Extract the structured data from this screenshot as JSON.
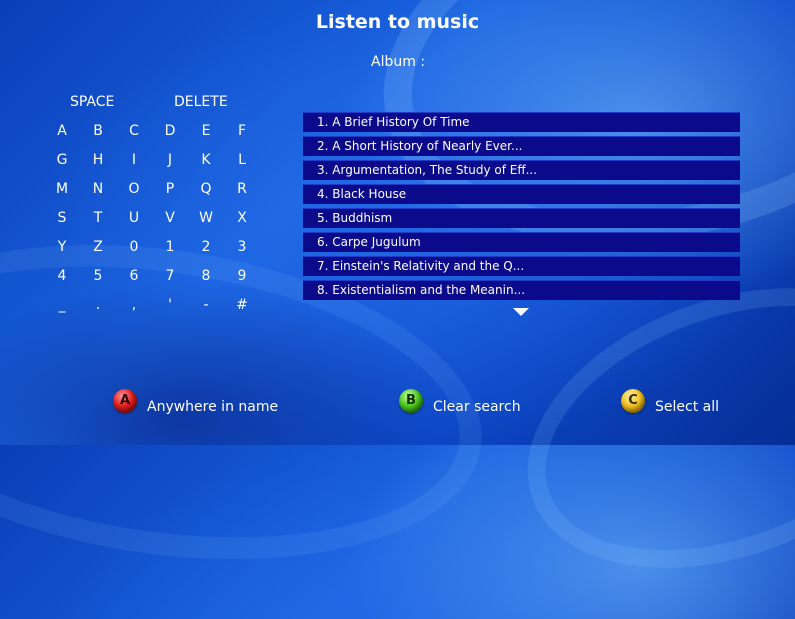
{
  "header": {
    "title": "Listen to music",
    "album_label": "Album :"
  },
  "keyboard": {
    "space": "SPACE",
    "delete": "DELETE",
    "rows": [
      [
        "A",
        "B",
        "C",
        "D",
        "E",
        "F"
      ],
      [
        "G",
        "H",
        "I",
        "J",
        "K",
        "L"
      ],
      [
        "M",
        "N",
        "O",
        "P",
        "Q",
        "R"
      ],
      [
        "S",
        "T",
        "U",
        "V",
        "W",
        "X"
      ],
      [
        "Y",
        "Z",
        "0",
        "1",
        "2",
        "3"
      ],
      [
        "4",
        "5",
        "6",
        "7",
        "8",
        "9"
      ],
      [
        "_",
        ".",
        ",",
        "'",
        "-",
        "#"
      ]
    ]
  },
  "albums": [
    "1. A Brief History Of Time",
    "2. A Short History of Nearly Ever...",
    "3. Argumentation, The Study of Eff...",
    "4. Black House",
    "5. Buddhism",
    "6. Carpe Jugulum",
    "7. Einstein's Relativity and the Q...",
    "8. Existentialism and the Meanin..."
  ],
  "buttons": {
    "a": {
      "key": "A",
      "label": "Anywhere in name"
    },
    "b": {
      "key": "B",
      "label": "Clear search"
    },
    "c": {
      "key": "C",
      "label": "Select all"
    }
  },
  "icons": {
    "scroll": "chevron-down-icon"
  },
  "colors": {
    "row_bg": "#0a0a8a",
    "red": "#e02020",
    "green": "#4cc820",
    "yellow": "#f0c020"
  }
}
